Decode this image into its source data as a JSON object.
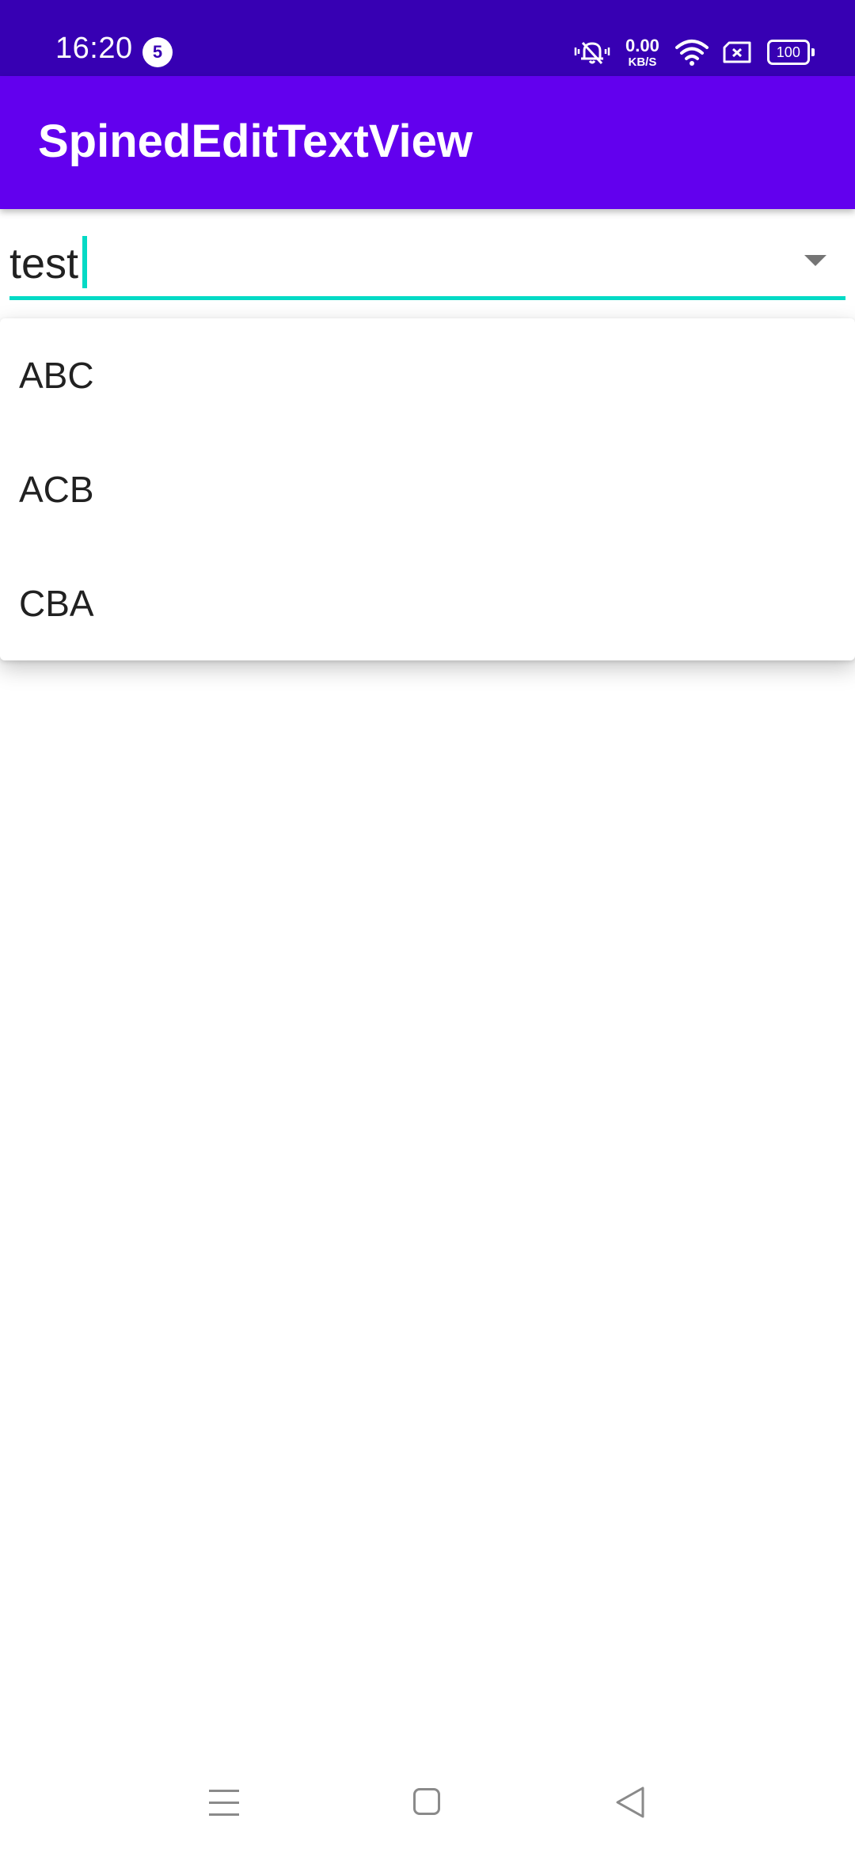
{
  "status_bar": {
    "time": "16:20",
    "notification_count": "5",
    "net_speed_value": "0.00",
    "net_speed_unit": "KB/S",
    "battery_level": "100"
  },
  "app_bar": {
    "title": "SpinedEditTextView"
  },
  "spinner": {
    "input_value": "test",
    "accent_color": "#03DAC5",
    "options": [
      "ABC",
      "ACB",
      "CBA"
    ]
  },
  "colors": {
    "status_bar": "#3700B3",
    "app_bar": "#6200EE",
    "accent": "#03DAC5"
  },
  "icons": {
    "status": [
      "mute-icon",
      "wifi-icon",
      "sim-icon",
      "battery-icon"
    ],
    "spinner": "dropdown-arrow-icon",
    "nav": [
      "menu-icon",
      "home-icon",
      "back-icon"
    ]
  }
}
